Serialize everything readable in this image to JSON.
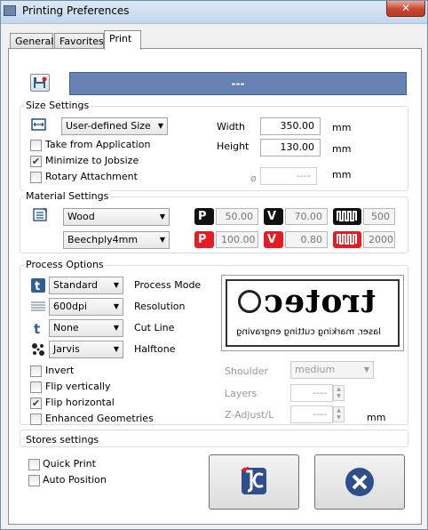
{
  "window": {
    "title": "Printing Preferences",
    "close_glyph": "✕"
  },
  "tabs": [
    {
      "label": "General"
    },
    {
      "label": "Favorites"
    },
    {
      "label": "Print"
    }
  ],
  "header_bar": {
    "text": "---",
    "color": "#6683b3"
  },
  "size_settings": {
    "title": "Size Settings",
    "size_combo": "User-defined Size",
    "take_from_app": {
      "label": "Take from Application",
      "checked": false
    },
    "minimize_jobsize": {
      "label": "Minimize to Jobsize",
      "checked": true
    },
    "rotary": {
      "label": "Rotary Attachment",
      "checked": false
    },
    "width_label": "Width",
    "width_value": "350.00",
    "width_unit": "mm",
    "height_label": "Height",
    "height_value": "130.00",
    "height_unit": "mm",
    "diameter_symbol": "ø",
    "diameter_value": "----",
    "diameter_unit": "mm"
  },
  "material_settings": {
    "title": "Material Settings",
    "material": "Wood",
    "submaterial": "Beechply4mm",
    "row1": {
      "p": "50.00",
      "v": "70.00",
      "f": "500"
    },
    "row2": {
      "p": "100.00",
      "v": "0.80",
      "f": "2000"
    },
    "badges": {
      "p": "P",
      "v": "V"
    }
  },
  "process_options": {
    "title": "Process Options",
    "mode_value": "Standard",
    "mode_label": "Process Mode",
    "resolution_value": "600dpi",
    "resolution_label": "Resolution",
    "cutline_value": "None",
    "cutline_label": "Cut Line",
    "halftone_value": "Jarvis",
    "halftone_label": "Halftone",
    "invert": {
      "label": "Invert",
      "checked": false
    },
    "flip_vertically": {
      "label": "Flip vertically",
      "checked": false
    },
    "flip_horizontal": {
      "label": "Flip horizontal",
      "checked": true
    },
    "enhanced_geometries": {
      "label": "Enhanced Geometries",
      "checked": false
    },
    "preview": {
      "logo_text": "trotec",
      "tagline": "laser. marking cutting engraving"
    },
    "shoulder_label": "Shoulder",
    "shoulder_value": "medium",
    "layers_label": "Layers",
    "layers_value": "----",
    "zadjust_label": "Z-Adjust/L",
    "zadjust_value": "----",
    "zadjust_unit": "mm"
  },
  "stores_settings": {
    "title": "Stores settings",
    "quick_print": {
      "label": "Quick Print",
      "checked": false
    },
    "auto_position": {
      "label": "Auto Position",
      "checked": false
    }
  },
  "colors": {
    "accent_red": "#e81b23",
    "cancel_blue": "#2e4f8c"
  }
}
